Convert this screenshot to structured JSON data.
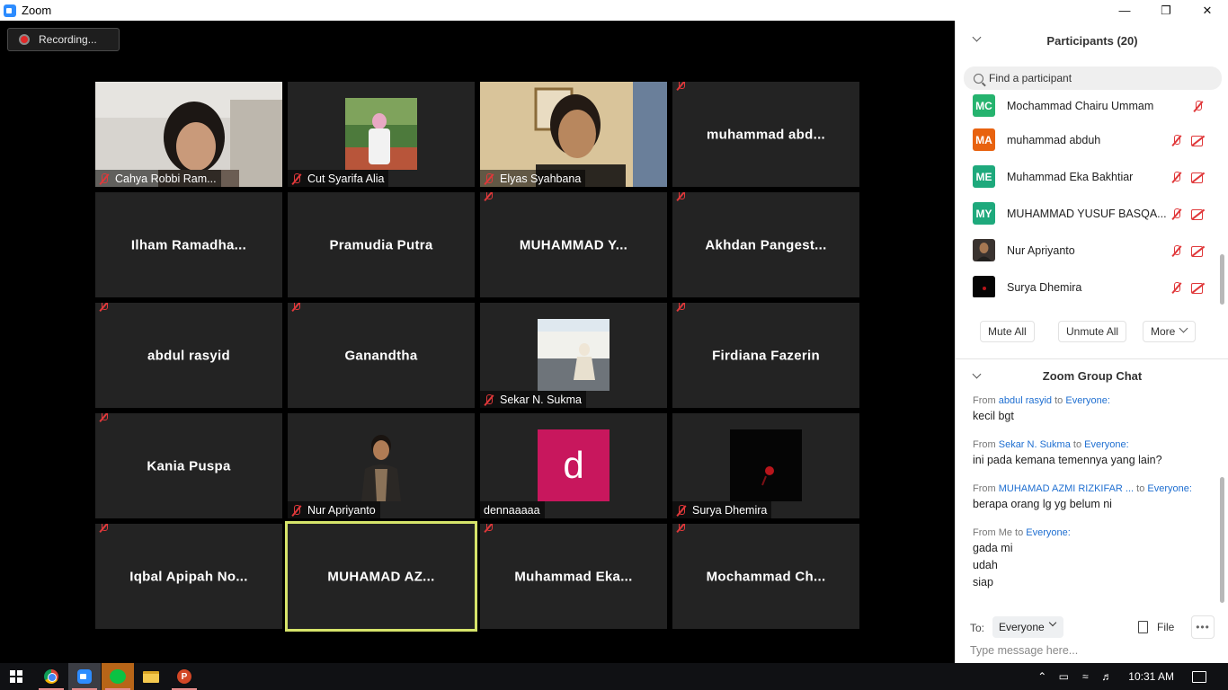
{
  "window": {
    "title": "Zoom"
  },
  "recording": {
    "label": "Recording..."
  },
  "tiles": [
    {
      "label": "Cahya Robbi Ram...",
      "type": "video"
    },
    {
      "label": "Cut Syarifa Alia",
      "type": "photo"
    },
    {
      "label": "Elyas Syahbana",
      "type": "video"
    },
    {
      "label": "muhammad  abd...",
      "type": "name"
    },
    {
      "label": "Ilham  Ramadha...",
      "type": "name"
    },
    {
      "label": "Pramudia Putra",
      "type": "name"
    },
    {
      "label": "MUHAMMAD  Y...",
      "type": "name"
    },
    {
      "label": "Akhdan  Pangest...",
      "type": "name"
    },
    {
      "label": "abdul rasyid",
      "type": "name"
    },
    {
      "label": "Ganandtha",
      "type": "name"
    },
    {
      "label": "Sekar N. Sukma",
      "type": "photo"
    },
    {
      "label": "Firdiana Fazerin",
      "type": "name"
    },
    {
      "label": "Kania Puspa",
      "type": "name"
    },
    {
      "label": "Nur Apriyanto",
      "type": "photo"
    },
    {
      "label": "dennaaaaa",
      "type": "avatar",
      "letter": "d"
    },
    {
      "label": "Surya Dhemira",
      "type": "photo"
    },
    {
      "label": "Iqbal  Apipah  No...",
      "type": "name"
    },
    {
      "label": "MUHAMAD  AZ...",
      "type": "name"
    },
    {
      "label": "Muhammad  Eka...",
      "type": "name"
    },
    {
      "label": "Mochammad  Ch...",
      "type": "name"
    }
  ],
  "participants_panel": {
    "title": "Participants (20)",
    "search_placeholder": "Find a participant",
    "participants": [
      {
        "initials": "MC",
        "name": "Mochammad Chairu Ummam",
        "color": "#25b36e"
      },
      {
        "initials": "MA",
        "name": "muhammad abduh",
        "color": "#e8620f"
      },
      {
        "initials": "ME",
        "name": "Muhammad Eka Bakhtiar",
        "color": "#1ea97c"
      },
      {
        "initials": "MY",
        "name": "MUHAMMAD YUSUF BASQA...",
        "color": "#1ea97c"
      },
      {
        "initials": "",
        "name": "Nur Apriyanto",
        "color": "#5a4a40"
      },
      {
        "initials": "",
        "name": "Surya Dhemira",
        "color": "#111111"
      }
    ],
    "buttons": {
      "mute_all": "Mute All",
      "unmute_all": "Unmute All",
      "more": "More"
    }
  },
  "chat": {
    "title": "Zoom Group Chat",
    "messages": [
      {
        "from": "From ",
        "sender": "abdul rasyid",
        "to_word": " to ",
        "recipient": "Everyone:",
        "lines": [
          "kecil bgt"
        ]
      },
      {
        "from": "From ",
        "sender": "Sekar N. Sukma",
        "to_word": " to ",
        "recipient": "Everyone:",
        "lines": [
          "ini pada kemana temennya yang lain?"
        ]
      },
      {
        "from": "From ",
        "sender": "MUHAMAD AZMI RIZKIFAR ...",
        "to_word": " to ",
        "recipient": "Everyone:",
        "lines": [
          "berapa orang lg yg belum ni"
        ]
      },
      {
        "from": "From Me",
        "sender": "",
        "to_word": " to ",
        "recipient": "Everyone:",
        "lines": [
          "gada mi",
          "udah",
          "siap"
        ]
      }
    ],
    "to_label": "To:",
    "to_value": "Everyone",
    "file_label": "File",
    "input_placeholder": "Type message here..."
  },
  "taskbar": {
    "time": "10:31 AM"
  }
}
